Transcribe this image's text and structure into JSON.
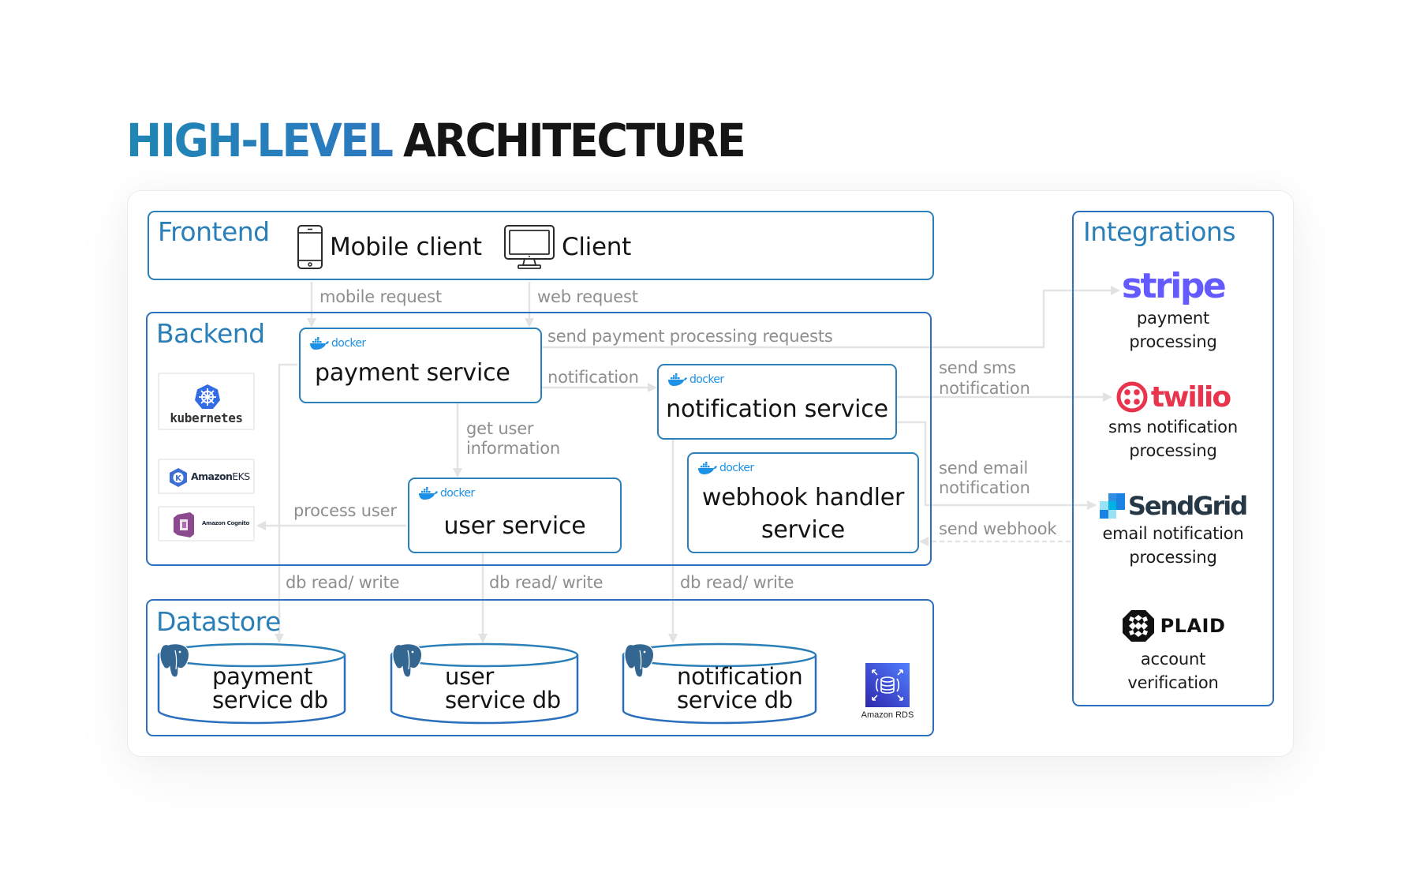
{
  "title": {
    "part1": "HIGH-LEVEL",
    "part2": "ARCHITECTURE"
  },
  "groups": {
    "frontend": "Frontend",
    "backend": "Backend",
    "datastore": "Datastore",
    "integrations": "Integrations"
  },
  "frontend": {
    "clients": [
      {
        "label": "Mobile client",
        "icon": "smartphone-icon"
      },
      {
        "label": "Client",
        "icon": "desktop-monitor-icon"
      }
    ]
  },
  "backend": {
    "platform_logos": [
      {
        "name": "kubernetes",
        "label": "kubernetes",
        "color": "#326ce5"
      },
      {
        "name": "amazon-eks",
        "label_bold": "Amazon",
        "label_light": "EKS",
        "color": "#3b6fd6"
      },
      {
        "name": "amazon-cognito",
        "label": "Amazon Cognito",
        "color": "#8c4a8e"
      }
    ],
    "docker_label": "docker",
    "services": {
      "payment": "payment service",
      "notification": "notification service",
      "webhook_line1": "webhook handler",
      "webhook_line2": "service",
      "user": "user service"
    }
  },
  "edges": {
    "mobile_request": "mobile request",
    "web_request": "web request",
    "send_payment": "send payment processing requests",
    "notification": "notification",
    "get_user_1": "get user",
    "get_user_2": "information",
    "process_user": "process user",
    "send_sms_1": "send sms",
    "send_sms_2": "notification",
    "send_email_1": "send email",
    "send_email_2": "notification",
    "send_webhook": "send webhook",
    "db_rw": "db read/ write"
  },
  "datastore": {
    "dbs": [
      {
        "line1": "payment",
        "line2": "service db"
      },
      {
        "line1": "user",
        "line2": "service db"
      },
      {
        "line1": "notification",
        "line2": "service db"
      }
    ],
    "rds_label": "Amazon RDS"
  },
  "integrations": [
    {
      "brand": "stripe",
      "color": "#635bff",
      "desc1": "payment",
      "desc2": "processing"
    },
    {
      "brand": "twilio",
      "color": "#e8344c",
      "desc1": "sms notification",
      "desc2": "processing"
    },
    {
      "brand": "SendGrid",
      "color": "#263746",
      "desc1": "email notification",
      "desc2": "processing"
    },
    {
      "brand": "PLAID",
      "color": "#111111",
      "desc1": "account",
      "desc2": "verification"
    }
  ],
  "colors": {
    "title_blue": "#1f86b4",
    "group_border": "#2d6fbf",
    "group_label": "#2a7fb8",
    "connector": "#e2e2e2",
    "edge_label": "#8e8e8e",
    "docker_blue": "#1d91e6",
    "postgres_blue": "#336791"
  }
}
